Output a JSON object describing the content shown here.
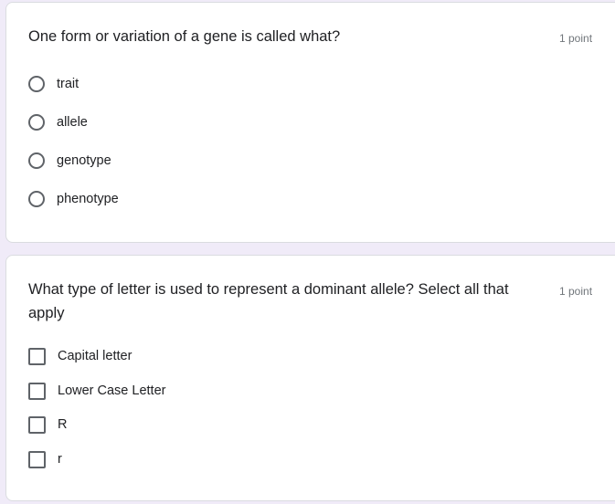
{
  "questions": [
    {
      "title": "One form or variation of a gene is called what?",
      "points": "1 point",
      "type": "radio",
      "options": [
        "trait",
        "allele",
        "genotype",
        "phenotype"
      ]
    },
    {
      "title": "What type of letter is used to represent a dominant allele? Select all that apply",
      "points": "1 point",
      "type": "checkbox",
      "options": [
        "Capital letter",
        "Lower Case Letter",
        "R",
        "r"
      ]
    }
  ]
}
